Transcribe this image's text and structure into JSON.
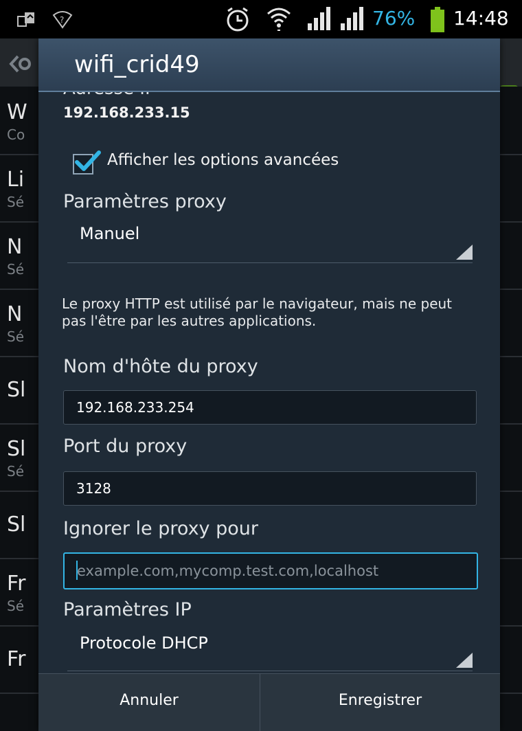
{
  "status_bar": {
    "battery_percent": "76%",
    "time": "14:48",
    "battery_color": "#7fc31c",
    "battery_text_color": "#33b5e5"
  },
  "background_list": {
    "rows": [
      {
        "title": "W",
        "subtitle": "Co"
      },
      {
        "title": "Li",
        "subtitle": "Sé"
      },
      {
        "title": "N",
        "subtitle": "Sé"
      },
      {
        "title": "N",
        "subtitle": "Sé"
      },
      {
        "title": "Sl",
        "subtitle": ""
      },
      {
        "title": "Sl",
        "subtitle": "Sé"
      },
      {
        "title": "Sl",
        "subtitle": ""
      },
      {
        "title": "Fr",
        "subtitle": "Sé"
      },
      {
        "title": "Fr",
        "subtitle": ""
      }
    ]
  },
  "dialog": {
    "title": "wifi_crid49",
    "ip_label_cut": "Adresse IP",
    "ip_value": "192.168.233.15",
    "show_advanced": {
      "label": "Afficher les options avancées",
      "checked": true
    },
    "proxy_settings": {
      "label": "Paramètres proxy",
      "value": "Manuel"
    },
    "proxy_help": "Le proxy HTTP est utilisé par le navigateur, mais ne peut pas l'être par les autres applications.",
    "proxy_hostname": {
      "label": "Nom d'hôte du proxy",
      "value": "192.168.233.254"
    },
    "proxy_port": {
      "label": "Port du proxy",
      "value": "3128"
    },
    "bypass_proxy": {
      "label": "Ignorer le proxy pour",
      "placeholder": "example.com,mycomp.test.com,localhost"
    },
    "ip_settings": {
      "label": "Paramètres IP",
      "value": "Protocole DHCP"
    },
    "buttons": {
      "cancel": "Annuler",
      "save": "Enregistrer"
    }
  },
  "colors": {
    "accent": "#33b5e5",
    "dialog_bg": "#1f2b37",
    "title_bar": "#3d536a"
  },
  "icons": [
    "screenshot-icon",
    "wifi-question-icon",
    "alarm-icon",
    "wifi-icon",
    "signal-icon",
    "battery-icon",
    "checkmark-icon",
    "dropdown-triangle-icon"
  ]
}
